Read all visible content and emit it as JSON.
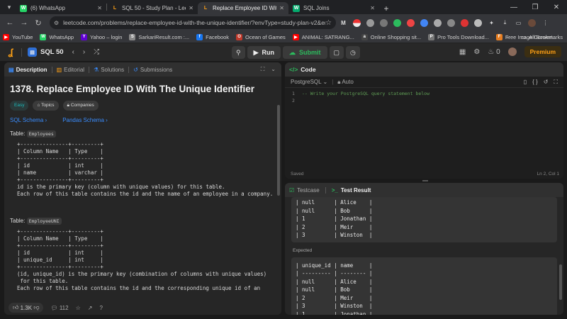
{
  "browser": {
    "tabs": [
      {
        "title": "(6) WhatsApp",
        "fav_color": "#25d366",
        "fav_char": "W",
        "active": false
      },
      {
        "title": "SQL 50 - Study Plan - LeetCode",
        "fav_color": "#ffa116",
        "fav_char": "L",
        "active": false
      },
      {
        "title": "Replace Employee ID With The",
        "fav_color": "#ffa116",
        "fav_char": "L",
        "active": true
      },
      {
        "title": "SQL Joins",
        "fav_color": "#04aa6d",
        "fav_char": "W",
        "active": false
      }
    ],
    "url": "leetcode.com/problems/replace-employee-id-with-the-unique-identifier/?envType=study-plan-v2&envId=top...",
    "bookmarks": [
      {
        "label": "YouTube",
        "color": "#ff0000",
        "char": "▶"
      },
      {
        "label": "WhatsApp",
        "color": "#25d366",
        "char": "W"
      },
      {
        "label": "Yahoo – login",
        "color": "#6001d2",
        "char": "Y"
      },
      {
        "label": "SarkariResult.com :...",
        "color": "#888888",
        "char": "S"
      },
      {
        "label": "Facebook",
        "color": "#1877f2",
        "char": "f"
      },
      {
        "label": "Ocean of Games",
        "color": "#c0392b",
        "char": "O"
      },
      {
        "label": "ANIMAL: SATRANG...",
        "color": "#ff0000",
        "char": "▶"
      },
      {
        "label": "Online Shopping sit...",
        "color": "#444444",
        "char": "a"
      },
      {
        "label": "Pro Tools Download...",
        "color": "#777777",
        "char": "P"
      },
      {
        "label": "Free Image Convert...",
        "color": "#e67e22",
        "char": "F"
      }
    ],
    "all_bookmarks": "All Bookmarks",
    "more": "»"
  },
  "lc": {
    "study_plan": "SQL 50",
    "run_label": "Run",
    "submit_label": "Submit",
    "fire_count": "0",
    "premium": "Premium"
  },
  "left": {
    "tabs": {
      "description": "Description",
      "editorial": "Editorial",
      "solutions": "Solutions",
      "submissions": "Submissions"
    },
    "title": "1378. Replace Employee ID With The Unique Identifier",
    "difficulty": "Easy",
    "topics": "Topics",
    "companies": "Companies",
    "sql_schema": "SQL Schema",
    "pandas_schema": "Pandas Schema",
    "table1_label": "Table:",
    "table1_name": "Employees",
    "table1_pre": "+---------------+---------+\n| Column Name   | Type    |\n+---------------+---------+\n| id            | int     |\n| name          | varchar |\n+---------------+---------+\nid is the primary key (column with unique values) for this table.\nEach row of this table contains the id and the name of an employee in a company.",
    "table2_label": "Table:",
    "table2_name": "EmployeeUNI",
    "table2_pre": "+---------------+---------+\n| Column Name   | Type    |\n+---------------+---------+\n| id            | int     |\n| unique_id     | int     |\n+---------------+---------+\n(id, unique_id) is the primary key (combination of columns with unique values)\n for this table.\nEach row of this table contains the id and the corresponding unique id of an",
    "likes": "1.3K",
    "comments": "112"
  },
  "code": {
    "header": "Code",
    "language": "PostgreSQL",
    "auto": "Auto",
    "lines": [
      {
        "n": "1",
        "text": "-- Write your PostgreSQL query statement below"
      },
      {
        "n": "2",
        "text": ""
      }
    ],
    "saved": "Saved",
    "cursor": "Ln 2, Col 1"
  },
  "test": {
    "tab_testcase": "Testcase",
    "tab_result": "Test Result",
    "output_pre": "| null      | Alice    |\n| null      | Bob      |\n| 1         | Jonathan |\n| 2         | Meir     |\n| 3         | Winston  |",
    "expected_label": "Expected",
    "expected_pre": "| unique_id | name     |\n| --------- | -------- |\n| null      | Alice    |\n| null      | Bob      |\n| 2         | Meir     |\n| 3         | Winston  |\n| 1         | Jonathan |"
  }
}
